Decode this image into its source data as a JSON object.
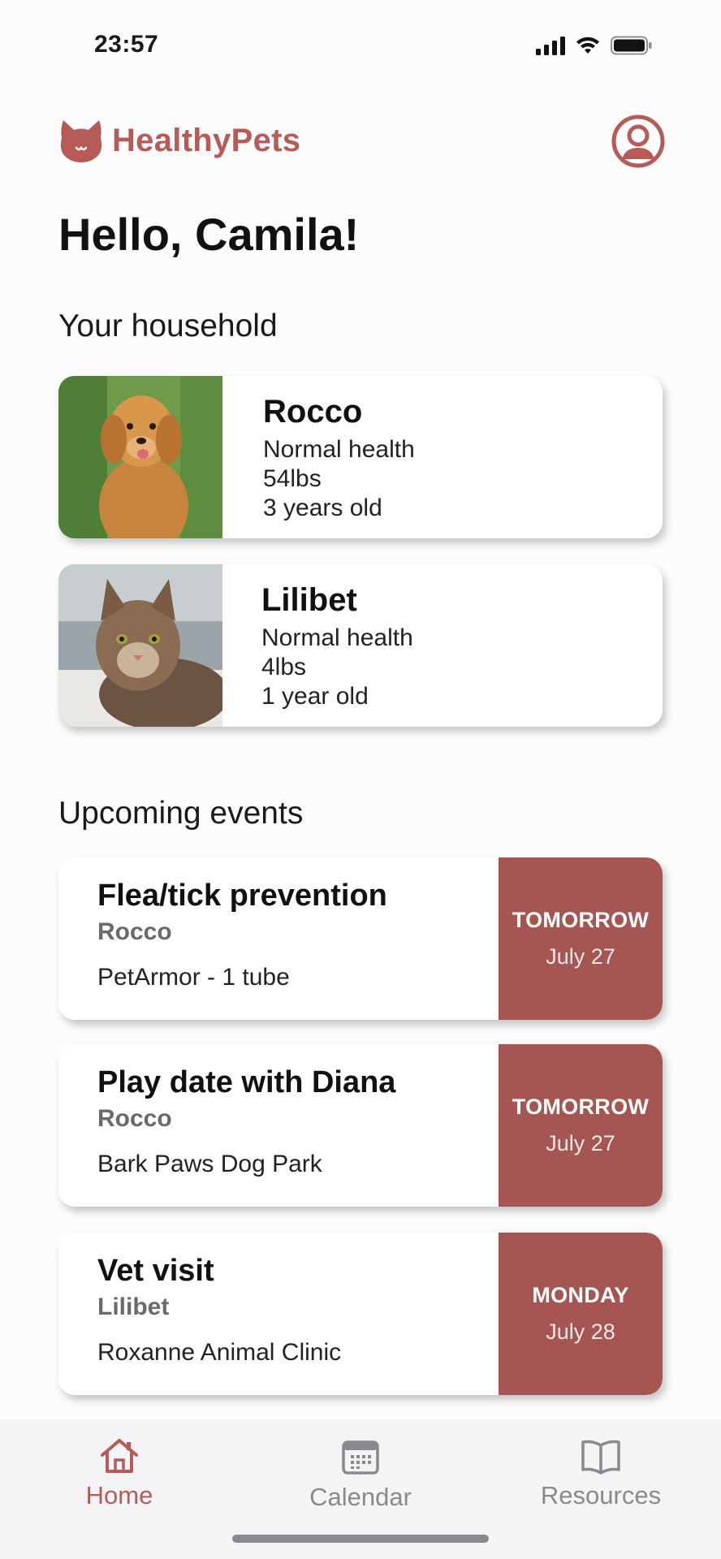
{
  "status_bar": {
    "time": "23:57"
  },
  "app": {
    "name": "HealthyPets"
  },
  "greeting": "Hello, Camila!",
  "household": {
    "title": "Your household",
    "pets": [
      {
        "name": "Rocco",
        "health": "Normal health",
        "weight": "54lbs",
        "age": "3 years old"
      },
      {
        "name": "Lilibet",
        "health": "Normal health",
        "weight": "4lbs",
        "age": "1 year old"
      }
    ]
  },
  "events": {
    "title": "Upcoming events",
    "items": [
      {
        "title": "Flea/tick prevention",
        "pet": "Rocco",
        "detail": "PetArmor - 1 tube",
        "day": "TOMORROW",
        "date": "July 27"
      },
      {
        "title": "Play date with Diana",
        "pet": "Rocco",
        "detail": "Bark Paws Dog Park",
        "day": "TOMORROW",
        "date": "July 27"
      },
      {
        "title": "Vet visit",
        "pet": "Lilibet",
        "detail": "Roxanne Animal Clinic",
        "day": "MONDAY",
        "date": "July 28"
      }
    ]
  },
  "tabs": [
    {
      "label": "Home",
      "icon": "house-icon",
      "active": true
    },
    {
      "label": "Calendar",
      "icon": "calendar-icon",
      "active": false
    },
    {
      "label": "Resources",
      "icon": "book-icon",
      "active": false
    }
  ],
  "colors": {
    "brand": "#b65b58",
    "event_date_bg": "#a55652",
    "tab_inactive": "#8a8a8e"
  }
}
